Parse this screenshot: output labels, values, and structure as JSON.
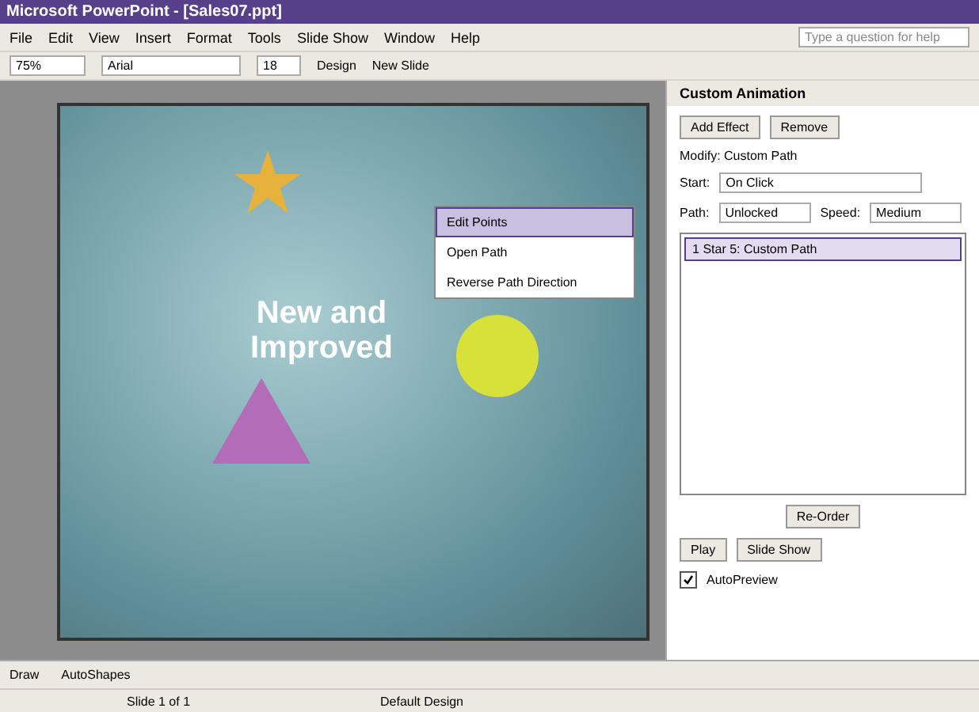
{
  "window": {
    "title": "Microsoft PowerPoint - [Sales07.ppt]"
  },
  "menu": [
    "File",
    "Edit",
    "View",
    "Insert",
    "Format",
    "Tools",
    "Slide Show",
    "Window",
    "Help"
  ],
  "help_box": {
    "placeholder": "Type a question for help"
  },
  "toolbar": {
    "zoom": "75%",
    "font": "Arial",
    "size": "18",
    "design": "Design",
    "new_slide": "New Slide"
  },
  "task_pane": {
    "title": "Custom Animation",
    "add_effect": "Add Effect",
    "remove": "Remove",
    "modify": "Modify: Custom Path",
    "start_label": "Start:",
    "start": "On Click",
    "path_label": "Path:",
    "path": "Unlocked",
    "speed_label": "Speed:",
    "speed": "Medium",
    "effects": [
      {
        "number": "1",
        "name": "Star 5: Custom Path",
        "selected": true
      }
    ],
    "reorder": "Re-Order",
    "play": "Play",
    "slide_show": "Slide Show",
    "autopreview": {
      "label": "AutoPreview",
      "checked": true
    }
  },
  "slide": {
    "title": "New and Improved"
  },
  "context_menu": [
    {
      "label": "Edit Points",
      "selected": true
    },
    {
      "label": "Open Path",
      "selected": false
    },
    {
      "label": "Reverse Path Direction",
      "selected": false
    }
  ],
  "drawing_toolbar": {
    "draw": "Draw",
    "autoshapes": "AutoShapes"
  },
  "status_bar": {
    "slide": "Slide 1 of 1",
    "design": "Default Design"
  }
}
